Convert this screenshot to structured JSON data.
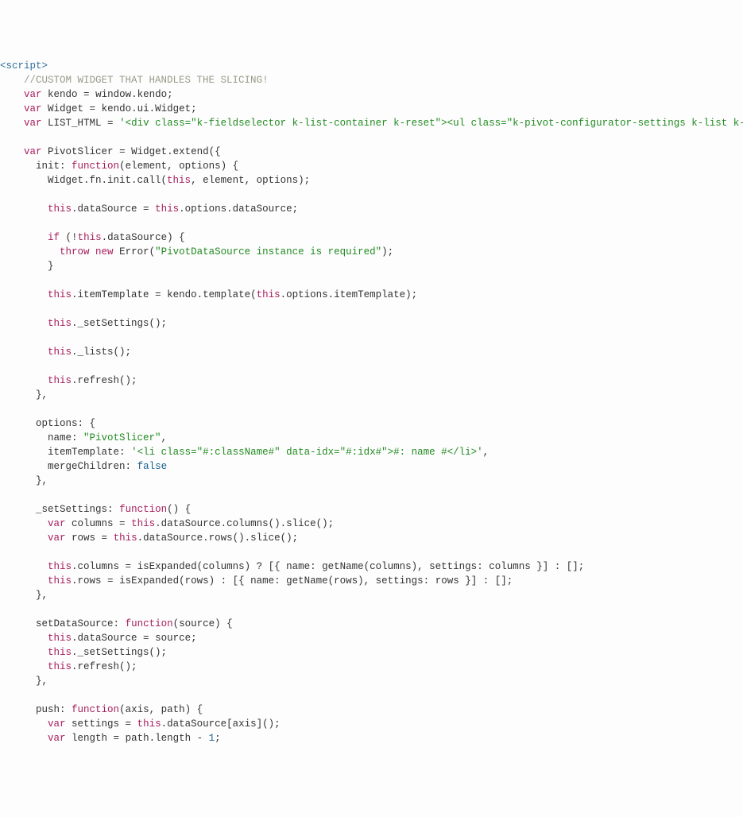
{
  "lines": [
    [
      {
        "cls": "tag",
        "t": "<script>"
      }
    ],
    [
      {
        "cls": "pln",
        "t": "    "
      },
      {
        "cls": "cmt",
        "t": "//CUSTOM WIDGET THAT HANDLES THE SLICING!"
      }
    ],
    [
      {
        "cls": "pln",
        "t": "    "
      },
      {
        "cls": "kw",
        "t": "var"
      },
      {
        "cls": "pln",
        "t": " kendo "
      },
      {
        "cls": "op",
        "t": "="
      },
      {
        "cls": "pln",
        "t": " window.kendo;"
      }
    ],
    [
      {
        "cls": "pln",
        "t": "    "
      },
      {
        "cls": "kw",
        "t": "var"
      },
      {
        "cls": "pln",
        "t": " Widget "
      },
      {
        "cls": "op",
        "t": "="
      },
      {
        "cls": "pln",
        "t": " kendo.ui.Widget;"
      }
    ],
    [
      {
        "cls": "pln",
        "t": "    "
      },
      {
        "cls": "kw",
        "t": "var"
      },
      {
        "cls": "pln",
        "t": " LIST_HTML "
      },
      {
        "cls": "op",
        "t": "="
      },
      {
        "cls": "pln",
        "t": " "
      },
      {
        "cls": "str",
        "t": "'<div class=\"k-fieldselector k-list-container k-reset\"><ul class=\"k-pivot-configurator-settings k-list k-reset k-pivot-setting\"/></div>'"
      },
      {
        "cls": "pln",
        "t": ";"
      }
    ],
    [
      {
        "cls": "pln",
        "t": ""
      }
    ],
    [
      {
        "cls": "pln",
        "t": "    "
      },
      {
        "cls": "kw",
        "t": "var"
      },
      {
        "cls": "pln",
        "t": " PivotSlicer "
      },
      {
        "cls": "op",
        "t": "="
      },
      {
        "cls": "pln",
        "t": " Widget.extend({"
      }
    ],
    [
      {
        "cls": "pln",
        "t": "      init"
      },
      {
        "cls": "op",
        "t": ":"
      },
      {
        "cls": "pln",
        "t": " "
      },
      {
        "cls": "kw",
        "t": "function"
      },
      {
        "cls": "pln",
        "t": "(element, options) {"
      }
    ],
    [
      {
        "cls": "pln",
        "t": "        Widget.fn.init.call("
      },
      {
        "cls": "kw",
        "t": "this"
      },
      {
        "cls": "pln",
        "t": ", element, options);"
      }
    ],
    [
      {
        "cls": "pln",
        "t": ""
      }
    ],
    [
      {
        "cls": "pln",
        "t": "        "
      },
      {
        "cls": "kw",
        "t": "this"
      },
      {
        "cls": "pln",
        "t": ".dataSource "
      },
      {
        "cls": "op",
        "t": "="
      },
      {
        "cls": "pln",
        "t": " "
      },
      {
        "cls": "kw",
        "t": "this"
      },
      {
        "cls": "pln",
        "t": ".options.dataSource;"
      }
    ],
    [
      {
        "cls": "pln",
        "t": ""
      }
    ],
    [
      {
        "cls": "pln",
        "t": "        "
      },
      {
        "cls": "kw",
        "t": "if"
      },
      {
        "cls": "pln",
        "t": " ("
      },
      {
        "cls": "op",
        "t": "!"
      },
      {
        "cls": "kw",
        "t": "this"
      },
      {
        "cls": "pln",
        "t": ".dataSource) {"
      }
    ],
    [
      {
        "cls": "pln",
        "t": "          "
      },
      {
        "cls": "kw",
        "t": "throw"
      },
      {
        "cls": "pln",
        "t": " "
      },
      {
        "cls": "kw",
        "t": "new"
      },
      {
        "cls": "pln",
        "t": " Error("
      },
      {
        "cls": "str",
        "t": "\"PivotDataSource instance is required\""
      },
      {
        "cls": "pln",
        "t": ");"
      }
    ],
    [
      {
        "cls": "pln",
        "t": "        }"
      }
    ],
    [
      {
        "cls": "pln",
        "t": ""
      }
    ],
    [
      {
        "cls": "pln",
        "t": "        "
      },
      {
        "cls": "kw",
        "t": "this"
      },
      {
        "cls": "pln",
        "t": ".itemTemplate "
      },
      {
        "cls": "op",
        "t": "="
      },
      {
        "cls": "pln",
        "t": " kendo.template("
      },
      {
        "cls": "kw",
        "t": "this"
      },
      {
        "cls": "pln",
        "t": ".options.itemTemplate);"
      }
    ],
    [
      {
        "cls": "pln",
        "t": ""
      }
    ],
    [
      {
        "cls": "pln",
        "t": "        "
      },
      {
        "cls": "kw",
        "t": "this"
      },
      {
        "cls": "pln",
        "t": "._setSettings();"
      }
    ],
    [
      {
        "cls": "pln",
        "t": ""
      }
    ],
    [
      {
        "cls": "pln",
        "t": "        "
      },
      {
        "cls": "kw",
        "t": "this"
      },
      {
        "cls": "pln",
        "t": "._lists();"
      }
    ],
    [
      {
        "cls": "pln",
        "t": ""
      }
    ],
    [
      {
        "cls": "pln",
        "t": "        "
      },
      {
        "cls": "kw",
        "t": "this"
      },
      {
        "cls": "pln",
        "t": ".refresh();"
      }
    ],
    [
      {
        "cls": "pln",
        "t": "      },"
      }
    ],
    [
      {
        "cls": "pln",
        "t": ""
      }
    ],
    [
      {
        "cls": "pln",
        "t": "      options"
      },
      {
        "cls": "op",
        "t": ":"
      },
      {
        "cls": "pln",
        "t": " {"
      }
    ],
    [
      {
        "cls": "pln",
        "t": "        name"
      },
      {
        "cls": "op",
        "t": ":"
      },
      {
        "cls": "pln",
        "t": " "
      },
      {
        "cls": "str",
        "t": "\"PivotSlicer\""
      },
      {
        "cls": "pln",
        "t": ","
      }
    ],
    [
      {
        "cls": "pln",
        "t": "        itemTemplate"
      },
      {
        "cls": "op",
        "t": ":"
      },
      {
        "cls": "pln",
        "t": " "
      },
      {
        "cls": "str",
        "t": "'<li class=\"#:className#\" data-idx=\"#:idx#\">#: name #</li>'"
      },
      {
        "cls": "pln",
        "t": ","
      }
    ],
    [
      {
        "cls": "pln",
        "t": "        mergeChildren"
      },
      {
        "cls": "op",
        "t": ":"
      },
      {
        "cls": "pln",
        "t": " "
      },
      {
        "cls": "bool",
        "t": "false"
      }
    ],
    [
      {
        "cls": "pln",
        "t": "      },"
      }
    ],
    [
      {
        "cls": "pln",
        "t": ""
      }
    ],
    [
      {
        "cls": "pln",
        "t": "      _setSettings"
      },
      {
        "cls": "op",
        "t": ":"
      },
      {
        "cls": "pln",
        "t": " "
      },
      {
        "cls": "kw",
        "t": "function"
      },
      {
        "cls": "pln",
        "t": "() {"
      }
    ],
    [
      {
        "cls": "pln",
        "t": "        "
      },
      {
        "cls": "kw",
        "t": "var"
      },
      {
        "cls": "pln",
        "t": " columns "
      },
      {
        "cls": "op",
        "t": "="
      },
      {
        "cls": "pln",
        "t": " "
      },
      {
        "cls": "kw",
        "t": "this"
      },
      {
        "cls": "pln",
        "t": ".dataSource.columns().slice();"
      }
    ],
    [
      {
        "cls": "pln",
        "t": "        "
      },
      {
        "cls": "kw",
        "t": "var"
      },
      {
        "cls": "pln",
        "t": " rows "
      },
      {
        "cls": "op",
        "t": "="
      },
      {
        "cls": "pln",
        "t": " "
      },
      {
        "cls": "kw",
        "t": "this"
      },
      {
        "cls": "pln",
        "t": ".dataSource.rows().slice();"
      }
    ],
    [
      {
        "cls": "pln",
        "t": ""
      }
    ],
    [
      {
        "cls": "pln",
        "t": "        "
      },
      {
        "cls": "kw",
        "t": "this"
      },
      {
        "cls": "pln",
        "t": ".columns "
      },
      {
        "cls": "op",
        "t": "="
      },
      {
        "cls": "pln",
        "t": " isExpanded(columns) "
      },
      {
        "cls": "op",
        "t": "?"
      },
      {
        "cls": "pln",
        "t": " [{ name"
      },
      {
        "cls": "op",
        "t": ":"
      },
      {
        "cls": "pln",
        "t": " getName(columns), settings"
      },
      {
        "cls": "op",
        "t": ":"
      },
      {
        "cls": "pln",
        "t": " columns }] "
      },
      {
        "cls": "op",
        "t": ":"
      },
      {
        "cls": "pln",
        "t": " [];"
      }
    ],
    [
      {
        "cls": "pln",
        "t": "        "
      },
      {
        "cls": "kw",
        "t": "this"
      },
      {
        "cls": "pln",
        "t": ".rows "
      },
      {
        "cls": "op",
        "t": "="
      },
      {
        "cls": "pln",
        "t": " isExpanded(rows) "
      },
      {
        "cls": "op",
        "t": ":"
      },
      {
        "cls": "pln",
        "t": " [{ name"
      },
      {
        "cls": "op",
        "t": ":"
      },
      {
        "cls": "pln",
        "t": " getName(rows), settings"
      },
      {
        "cls": "op",
        "t": ":"
      },
      {
        "cls": "pln",
        "t": " rows }] "
      },
      {
        "cls": "op",
        "t": ":"
      },
      {
        "cls": "pln",
        "t": " [];"
      }
    ],
    [
      {
        "cls": "pln",
        "t": "      },"
      }
    ],
    [
      {
        "cls": "pln",
        "t": ""
      }
    ],
    [
      {
        "cls": "pln",
        "t": "      setDataSource"
      },
      {
        "cls": "op",
        "t": ":"
      },
      {
        "cls": "pln",
        "t": " "
      },
      {
        "cls": "kw",
        "t": "function"
      },
      {
        "cls": "pln",
        "t": "(source) {"
      }
    ],
    [
      {
        "cls": "pln",
        "t": "        "
      },
      {
        "cls": "kw",
        "t": "this"
      },
      {
        "cls": "pln",
        "t": ".dataSource "
      },
      {
        "cls": "op",
        "t": "="
      },
      {
        "cls": "pln",
        "t": " source;"
      }
    ],
    [
      {
        "cls": "pln",
        "t": "        "
      },
      {
        "cls": "kw",
        "t": "this"
      },
      {
        "cls": "pln",
        "t": "._setSettings();"
      }
    ],
    [
      {
        "cls": "pln",
        "t": "        "
      },
      {
        "cls": "kw",
        "t": "this"
      },
      {
        "cls": "pln",
        "t": ".refresh();"
      }
    ],
    [
      {
        "cls": "pln",
        "t": "      },"
      }
    ],
    [
      {
        "cls": "pln",
        "t": ""
      }
    ],
    [
      {
        "cls": "pln",
        "t": "      push"
      },
      {
        "cls": "op",
        "t": ":"
      },
      {
        "cls": "pln",
        "t": " "
      },
      {
        "cls": "kw",
        "t": "function"
      },
      {
        "cls": "pln",
        "t": "(axis, path) {"
      }
    ],
    [
      {
        "cls": "pln",
        "t": "        "
      },
      {
        "cls": "kw",
        "t": "var"
      },
      {
        "cls": "pln",
        "t": " settings "
      },
      {
        "cls": "op",
        "t": "="
      },
      {
        "cls": "pln",
        "t": " "
      },
      {
        "cls": "kw",
        "t": "this"
      },
      {
        "cls": "pln",
        "t": ".dataSource[axis]();"
      }
    ],
    [
      {
        "cls": "pln",
        "t": "        "
      },
      {
        "cls": "kw",
        "t": "var"
      },
      {
        "cls": "pln",
        "t": " length "
      },
      {
        "cls": "op",
        "t": "="
      },
      {
        "cls": "pln",
        "t": " path.length "
      },
      {
        "cls": "op",
        "t": "-"
      },
      {
        "cls": "pln",
        "t": " "
      },
      {
        "cls": "num",
        "t": "1"
      },
      {
        "cls": "pln",
        "t": ";"
      }
    ]
  ]
}
